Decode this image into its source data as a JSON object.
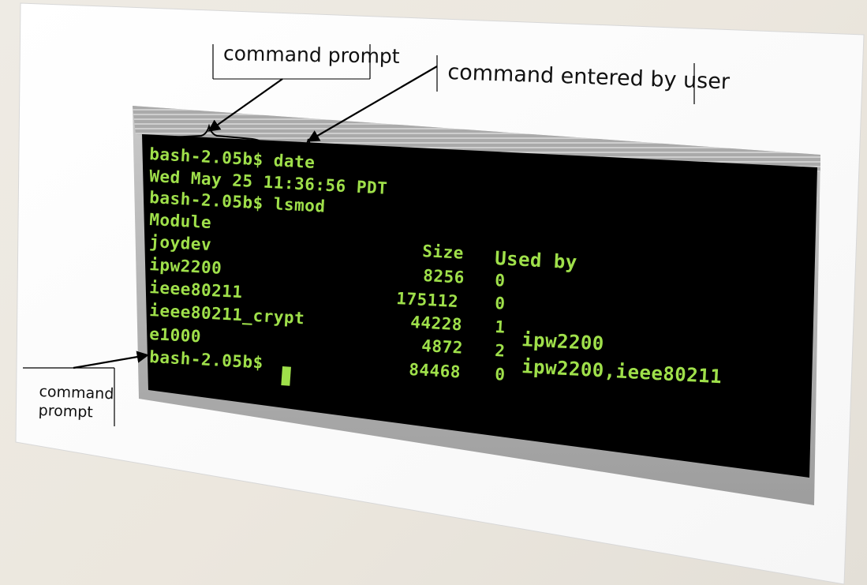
{
  "callouts": {
    "top_left": "command prompt",
    "top_right": "command entered by user",
    "bottom_left_line1": "command",
    "bottom_left_line2": "prompt"
  },
  "terminal": {
    "lines": [
      "bash-2.05b$ date",
      "Wed May 25 11:36:56 PDT",
      "bash-2.05b$ lsmod",
      "Module",
      "joydev",
      "ipw2200",
      "ieee80211",
      "ieee80211_crypt",
      "e1000",
      "bash-2.05b$"
    ],
    "table": {
      "size_header": "Size",
      "used_header": "Used by",
      "sizes": [
        "8256",
        "175112",
        "44228",
        "4872",
        "84468"
      ],
      "used_counts": [
        "0",
        "0",
        "1",
        "2",
        "0"
      ],
      "used_by": [
        "ipw2200",
        "ipw2200,ieee80211"
      ]
    },
    "text_color": "#9fe04a",
    "screen_color": "#000000"
  }
}
